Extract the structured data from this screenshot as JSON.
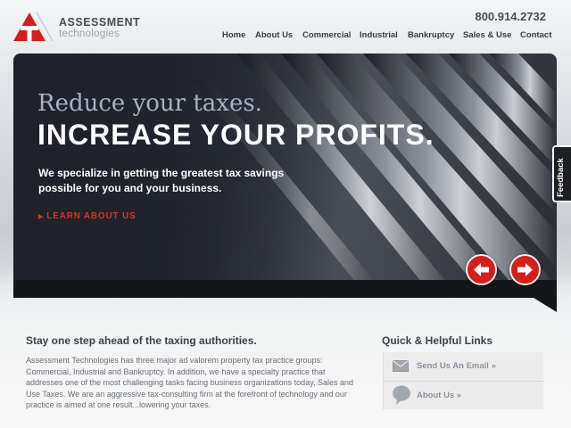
{
  "brand": {
    "name": "ASSESSMENT",
    "tagline": "technologies",
    "logo_color": "#d41f1a"
  },
  "header": {
    "phone": "800.914.2732"
  },
  "nav": {
    "items": [
      {
        "label": "Home"
      },
      {
        "label": "About Us"
      },
      {
        "label": "Commercial"
      },
      {
        "label": "Industrial"
      },
      {
        "label": "Bankruptcy"
      },
      {
        "label": "Sales & Use"
      },
      {
        "label": "Contact"
      }
    ]
  },
  "hero": {
    "headline_top": "Reduce your taxes.",
    "headline_main": "INCREASE YOUR PROFITS.",
    "text": "We specialize in getting the greatest tax savings possible for you and your business.",
    "link_label": "LEARN ABOUT US",
    "link_icon": "triangle-right-icon",
    "prev_icon": "arrow-left-icon",
    "next_icon": "arrow-right-icon",
    "accent_color": "#d6361f"
  },
  "feedback": {
    "label": "Feedback"
  },
  "main": {
    "title": "Stay one step ahead of the taxing authorities.",
    "body": "Assessment Technologies has three major ad valorem property tax practice groups: Commercial, Industrial and Bankruptcy. In addition, we have a specialty practice that addresses one of the most challenging tasks facing business organizations today, Sales and Use Taxes. We are an aggressive tax-consulting firm at the forefront of technology and our practice is aimed at one result...lowering your taxes."
  },
  "quick_links": {
    "title": "Quick & Helpful Links",
    "items": [
      {
        "label": "Send Us An Email »",
        "icon": "envelope-icon"
      },
      {
        "label": "About Us »",
        "icon": "speech-bubble-icon"
      }
    ]
  }
}
